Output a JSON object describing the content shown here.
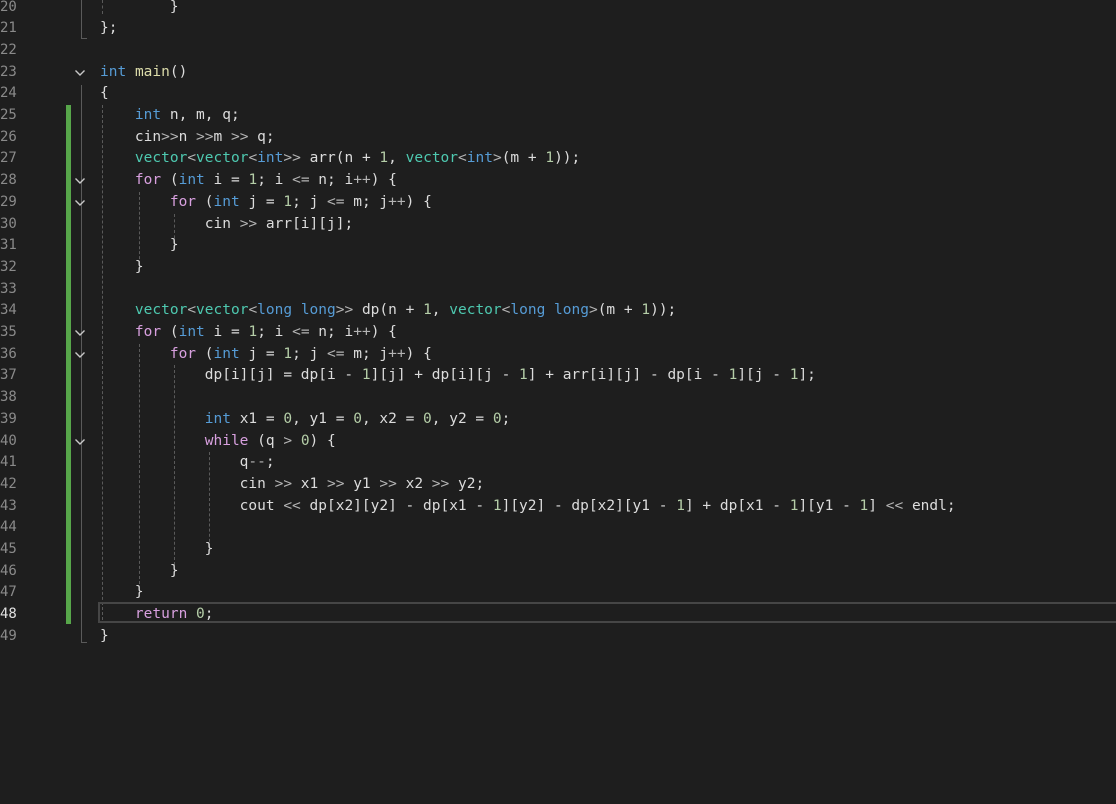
{
  "editor": {
    "current_line": "48",
    "lines": [
      {
        "n": "20",
        "tokens": [
          {
            "t": "        }",
            "c": "pl"
          }
        ]
      },
      {
        "n": "21",
        "tokens": [
          {
            "t": "};",
            "c": "pl"
          }
        ]
      },
      {
        "n": "22",
        "tokens": []
      },
      {
        "n": "23",
        "fold": true,
        "tokens": [
          {
            "t": "int",
            "c": "kw"
          },
          {
            "t": " ",
            "c": "pl"
          },
          {
            "t": "main",
            "c": "fn"
          },
          {
            "t": "()",
            "c": "pl"
          }
        ]
      },
      {
        "n": "24",
        "tokens": [
          {
            "t": "{",
            "c": "pl"
          }
        ]
      },
      {
        "n": "25",
        "tokens": [
          {
            "t": "    ",
            "c": "pl"
          },
          {
            "t": "int",
            "c": "kw"
          },
          {
            "t": " n, m, q;",
            "c": "pl"
          }
        ]
      },
      {
        "n": "26",
        "tokens": [
          {
            "t": "    cin",
            "c": "pl"
          },
          {
            "t": ">>",
            "c": "op"
          },
          {
            "t": "n ",
            "c": "pl"
          },
          {
            "t": ">>",
            "c": "op"
          },
          {
            "t": "m ",
            "c": "pl"
          },
          {
            "t": ">>",
            "c": "op"
          },
          {
            "t": " q;",
            "c": "pl"
          }
        ]
      },
      {
        "n": "27",
        "tokens": [
          {
            "t": "    ",
            "c": "pl"
          },
          {
            "t": "vector",
            "c": "ty"
          },
          {
            "t": "<",
            "c": "op"
          },
          {
            "t": "vector",
            "c": "ty"
          },
          {
            "t": "<",
            "c": "op"
          },
          {
            "t": "int",
            "c": "kw"
          },
          {
            "t": ">>",
            "c": "op"
          },
          {
            "t": " arr(n + ",
            "c": "pl"
          },
          {
            "t": "1",
            "c": "num"
          },
          {
            "t": ", ",
            "c": "pl"
          },
          {
            "t": "vector",
            "c": "ty"
          },
          {
            "t": "<",
            "c": "op"
          },
          {
            "t": "int",
            "c": "kw"
          },
          {
            "t": ">",
            "c": "op"
          },
          {
            "t": "(m + ",
            "c": "pl"
          },
          {
            "t": "1",
            "c": "num"
          },
          {
            "t": "));",
            "c": "pl"
          }
        ]
      },
      {
        "n": "28",
        "fold": true,
        "tokens": [
          {
            "t": "    ",
            "c": "pl"
          },
          {
            "t": "for",
            "c": "kw2"
          },
          {
            "t": " (",
            "c": "pl"
          },
          {
            "t": "int",
            "c": "kw"
          },
          {
            "t": " i = ",
            "c": "pl"
          },
          {
            "t": "1",
            "c": "num"
          },
          {
            "t": "; i ",
            "c": "pl"
          },
          {
            "t": "<=",
            "c": "op"
          },
          {
            "t": " n; i",
            "c": "pl"
          },
          {
            "t": "++",
            "c": "op"
          },
          {
            "t": ") {",
            "c": "pl"
          }
        ]
      },
      {
        "n": "29",
        "fold": true,
        "tokens": [
          {
            "t": "        ",
            "c": "pl"
          },
          {
            "t": "for",
            "c": "kw2"
          },
          {
            "t": " (",
            "c": "pl"
          },
          {
            "t": "int",
            "c": "kw"
          },
          {
            "t": " j = ",
            "c": "pl"
          },
          {
            "t": "1",
            "c": "num"
          },
          {
            "t": "; j ",
            "c": "pl"
          },
          {
            "t": "<=",
            "c": "op"
          },
          {
            "t": " m; j",
            "c": "pl"
          },
          {
            "t": "++",
            "c": "op"
          },
          {
            "t": ") {",
            "c": "pl"
          }
        ]
      },
      {
        "n": "30",
        "tokens": [
          {
            "t": "            cin ",
            "c": "pl"
          },
          {
            "t": ">>",
            "c": "op"
          },
          {
            "t": " arr[i][j];",
            "c": "pl"
          }
        ]
      },
      {
        "n": "31",
        "tokens": [
          {
            "t": "        }",
            "c": "pl"
          }
        ]
      },
      {
        "n": "32",
        "tokens": [
          {
            "t": "    }",
            "c": "pl"
          }
        ]
      },
      {
        "n": "33",
        "tokens": []
      },
      {
        "n": "34",
        "tokens": [
          {
            "t": "    ",
            "c": "pl"
          },
          {
            "t": "vector",
            "c": "ty"
          },
          {
            "t": "<",
            "c": "op"
          },
          {
            "t": "vector",
            "c": "ty"
          },
          {
            "t": "<",
            "c": "op"
          },
          {
            "t": "long long",
            "c": "kw"
          },
          {
            "t": ">>",
            "c": "op"
          },
          {
            "t": " dp(n + ",
            "c": "pl"
          },
          {
            "t": "1",
            "c": "num"
          },
          {
            "t": ", ",
            "c": "pl"
          },
          {
            "t": "vector",
            "c": "ty"
          },
          {
            "t": "<",
            "c": "op"
          },
          {
            "t": "long long",
            "c": "kw"
          },
          {
            "t": ">",
            "c": "op"
          },
          {
            "t": "(m + ",
            "c": "pl"
          },
          {
            "t": "1",
            "c": "num"
          },
          {
            "t": "));",
            "c": "pl"
          }
        ]
      },
      {
        "n": "35",
        "fold": true,
        "tokens": [
          {
            "t": "    ",
            "c": "pl"
          },
          {
            "t": "for",
            "c": "kw2"
          },
          {
            "t": " (",
            "c": "pl"
          },
          {
            "t": "int",
            "c": "kw"
          },
          {
            "t": " i = ",
            "c": "pl"
          },
          {
            "t": "1",
            "c": "num"
          },
          {
            "t": "; i ",
            "c": "pl"
          },
          {
            "t": "<=",
            "c": "op"
          },
          {
            "t": " n; i",
            "c": "pl"
          },
          {
            "t": "++",
            "c": "op"
          },
          {
            "t": ") {",
            "c": "pl"
          }
        ]
      },
      {
        "n": "36",
        "fold": true,
        "tokens": [
          {
            "t": "        ",
            "c": "pl"
          },
          {
            "t": "for",
            "c": "kw2"
          },
          {
            "t": " (",
            "c": "pl"
          },
          {
            "t": "int",
            "c": "kw"
          },
          {
            "t": " j = ",
            "c": "pl"
          },
          {
            "t": "1",
            "c": "num"
          },
          {
            "t": "; j ",
            "c": "pl"
          },
          {
            "t": "<=",
            "c": "op"
          },
          {
            "t": " m; j",
            "c": "pl"
          },
          {
            "t": "++",
            "c": "op"
          },
          {
            "t": ") {",
            "c": "pl"
          }
        ]
      },
      {
        "n": "37",
        "tokens": [
          {
            "t": "            dp[i][j] = dp[i - ",
            "c": "pl"
          },
          {
            "t": "1",
            "c": "num"
          },
          {
            "t": "][j] + dp[i][j - ",
            "c": "pl"
          },
          {
            "t": "1",
            "c": "num"
          },
          {
            "t": "] + arr[i][j] - dp[i - ",
            "c": "pl"
          },
          {
            "t": "1",
            "c": "num"
          },
          {
            "t": "][j - ",
            "c": "pl"
          },
          {
            "t": "1",
            "c": "num"
          },
          {
            "t": "];",
            "c": "pl"
          }
        ]
      },
      {
        "n": "38",
        "tokens": []
      },
      {
        "n": "39",
        "tokens": [
          {
            "t": "            ",
            "c": "pl"
          },
          {
            "t": "int",
            "c": "kw"
          },
          {
            "t": " x1 = ",
            "c": "pl"
          },
          {
            "t": "0",
            "c": "num"
          },
          {
            "t": ", y1 = ",
            "c": "pl"
          },
          {
            "t": "0",
            "c": "num"
          },
          {
            "t": ", x2 = ",
            "c": "pl"
          },
          {
            "t": "0",
            "c": "num"
          },
          {
            "t": ", y2 = ",
            "c": "pl"
          },
          {
            "t": "0",
            "c": "num"
          },
          {
            "t": ";",
            "c": "pl"
          }
        ]
      },
      {
        "n": "40",
        "fold": true,
        "tokens": [
          {
            "t": "            ",
            "c": "pl"
          },
          {
            "t": "while",
            "c": "kw2"
          },
          {
            "t": " (q ",
            "c": "pl"
          },
          {
            "t": ">",
            "c": "op"
          },
          {
            "t": " ",
            "c": "pl"
          },
          {
            "t": "0",
            "c": "num"
          },
          {
            "t": ") {",
            "c": "pl"
          }
        ]
      },
      {
        "n": "41",
        "tokens": [
          {
            "t": "                q",
            "c": "pl"
          },
          {
            "t": "--",
            "c": "op"
          },
          {
            "t": ";",
            "c": "pl"
          }
        ]
      },
      {
        "n": "42",
        "tokens": [
          {
            "t": "                cin ",
            "c": "pl"
          },
          {
            "t": ">>",
            "c": "op"
          },
          {
            "t": " x1 ",
            "c": "pl"
          },
          {
            "t": ">>",
            "c": "op"
          },
          {
            "t": " y1 ",
            "c": "pl"
          },
          {
            "t": ">>",
            "c": "op"
          },
          {
            "t": " x2 ",
            "c": "pl"
          },
          {
            "t": ">>",
            "c": "op"
          },
          {
            "t": " y2;",
            "c": "pl"
          }
        ]
      },
      {
        "n": "43",
        "tokens": [
          {
            "t": "                cout ",
            "c": "pl"
          },
          {
            "t": "<<",
            "c": "op"
          },
          {
            "t": " dp[x2][y2] - dp[x1 - ",
            "c": "pl"
          },
          {
            "t": "1",
            "c": "num"
          },
          {
            "t": "][y2] - dp[x2][y1 - ",
            "c": "pl"
          },
          {
            "t": "1",
            "c": "num"
          },
          {
            "t": "] + dp[x1 - ",
            "c": "pl"
          },
          {
            "t": "1",
            "c": "num"
          },
          {
            "t": "][y1 - ",
            "c": "pl"
          },
          {
            "t": "1",
            "c": "num"
          },
          {
            "t": "] ",
            "c": "pl"
          },
          {
            "t": "<<",
            "c": "op"
          },
          {
            "t": " endl;",
            "c": "pl"
          }
        ]
      },
      {
        "n": "44",
        "tokens": []
      },
      {
        "n": "45",
        "tokens": [
          {
            "t": "            }",
            "c": "pl"
          }
        ]
      },
      {
        "n": "46",
        "tokens": [
          {
            "t": "        }",
            "c": "pl"
          }
        ]
      },
      {
        "n": "47",
        "tokens": [
          {
            "t": "    }",
            "c": "pl"
          }
        ]
      },
      {
        "n": "48",
        "tokens": [
          {
            "t": "    ",
            "c": "pl"
          },
          {
            "t": "return",
            "c": "kw2"
          },
          {
            "t": " ",
            "c": "pl"
          },
          {
            "t": "0",
            "c": "num"
          },
          {
            "t": ";",
            "c": "pl"
          }
        ]
      },
      {
        "n": "49",
        "tokens": [
          {
            "t": "}",
            "c": "pl"
          }
        ]
      }
    ]
  }
}
